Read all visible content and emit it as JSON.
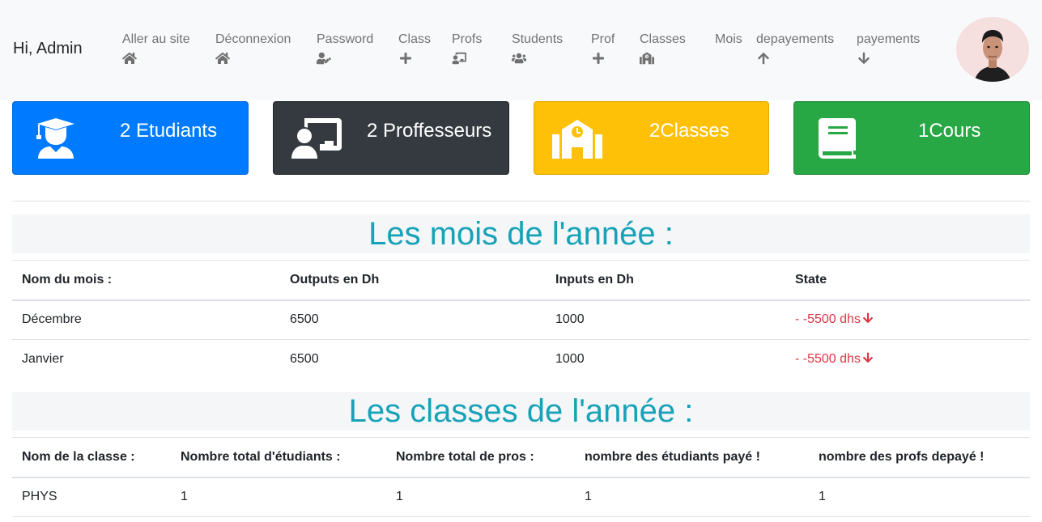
{
  "navbar": {
    "brand": "Hi, Admin",
    "items": [
      {
        "label": "Aller au site",
        "icon": "home-icon"
      },
      {
        "label": "Déconnexion",
        "icon": "home-icon"
      },
      {
        "label": "Password",
        "icon": "user-edit-icon"
      },
      {
        "label": "Class",
        "icon": "plus-icon"
      },
      {
        "label": "Profs",
        "icon": "chalkboard-teacher-icon"
      },
      {
        "label": "Students",
        "icon": "users-icon"
      },
      {
        "label": "Prof",
        "icon": "plus-icon"
      },
      {
        "label": "Classes",
        "icon": "school-icon"
      },
      {
        "label": "Mois",
        "icon": ""
      },
      {
        "label": "depayements",
        "icon": "arrow-up-icon"
      },
      {
        "label": "payements",
        "icon": "arrow-down-icon"
      }
    ]
  },
  "cards": [
    {
      "text": "2 Etudiants",
      "icon": "graduate-icon",
      "color": "#007bff"
    },
    {
      "text": "2 Proffesseurs",
      "icon": "chalkboard-teacher-icon",
      "color": "#343a40"
    },
    {
      "text": "2Classes",
      "icon": "school-icon",
      "color": "#ffc107"
    },
    {
      "text": "1Cours",
      "icon": "book-icon",
      "color": "#28a745"
    }
  ],
  "months": {
    "title": "Les mois de l'année :",
    "headers": [
      "Nom du mois :",
      "Outputs en Dh",
      "Inputs en Dh",
      "State"
    ],
    "rows": [
      [
        "Décembre",
        "6500",
        "1000",
        "- -5500 dhs"
      ],
      [
        "Janvier",
        "6500",
        "1000",
        "- -5500 dhs"
      ]
    ],
    "state_color": "#dc3545"
  },
  "classes": {
    "title": "Les classes de l'année :",
    "headers": [
      "Nom de la classe :",
      "Nombre total d'étudiants :",
      "Nombre total de pros :",
      "nombre des étudiants payé !",
      "nombre des profs depayé !"
    ],
    "rows": [
      [
        "PHYS",
        "1",
        "1",
        "1",
        "1"
      ]
    ]
  },
  "accent_color": "#17a2b8"
}
